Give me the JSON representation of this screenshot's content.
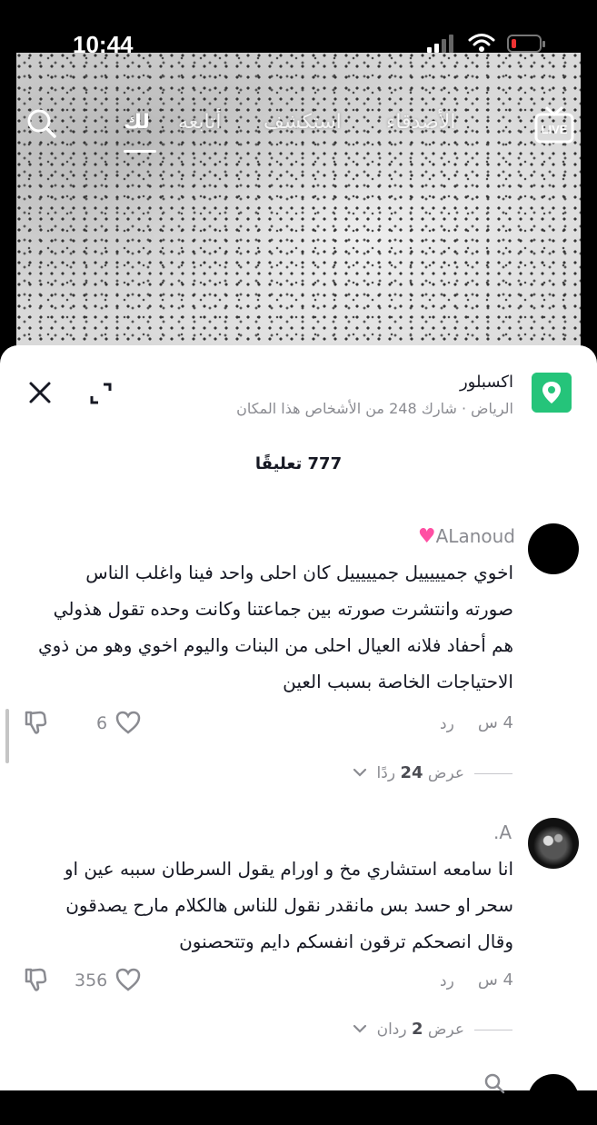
{
  "status_bar": {
    "time": "10:44"
  },
  "top_nav": {
    "tabs": [
      {
        "label": "لك"
      },
      {
        "label": "أتابعه"
      },
      {
        "label": "استكشف"
      },
      {
        "label": "الأصدقاء"
      }
    ],
    "live_label": "LIVE"
  },
  "location": {
    "title": "اكسبلور",
    "subtitle": "الرياض · شارك 248 من الأشخاص هذا المكان"
  },
  "comments_count": "777 تعليقًا",
  "comments": [
    {
      "username": "ALanoud",
      "text_lines": [
        "اخوي جميييييل جميييييل كان احلى واحد فينا واغلب الناس",
        "صورته وانتشرت صورته بين جماعتنا وكانت وحده تقول هذولي",
        "هم أحفاد فلانه العيال احلى من البنات واليوم اخوي وهو من ذوي",
        "الاحتياجات الخاصة بسبب العين"
      ],
      "time": "4 س",
      "reply_label": "رد",
      "likes": "6",
      "view_replies_prefix": "عرض",
      "view_replies_count": "24",
      "view_replies_suffix": "ردًا"
    },
    {
      "username": "A.",
      "text_lines": [
        "انا سامعه استشاري مخ و اورام يقول السرطان سببه عين او",
        "سحر او حسد بس مانقدر نقول للناس هالكلام مارح يصدقون",
        "وقال انصحكم ترقون انفسكم دايم وتتحصنون"
      ],
      "time": "4 س",
      "reply_label": "رد",
      "likes": "356",
      "view_replies_prefix": "عرض",
      "view_replies_count": "2",
      "view_replies_suffix": "ردان"
    }
  ],
  "colors": {
    "location_icon": "#25c47a",
    "heart_emoji": "#ff4fa3",
    "secondary_text": "#8a8b91"
  }
}
